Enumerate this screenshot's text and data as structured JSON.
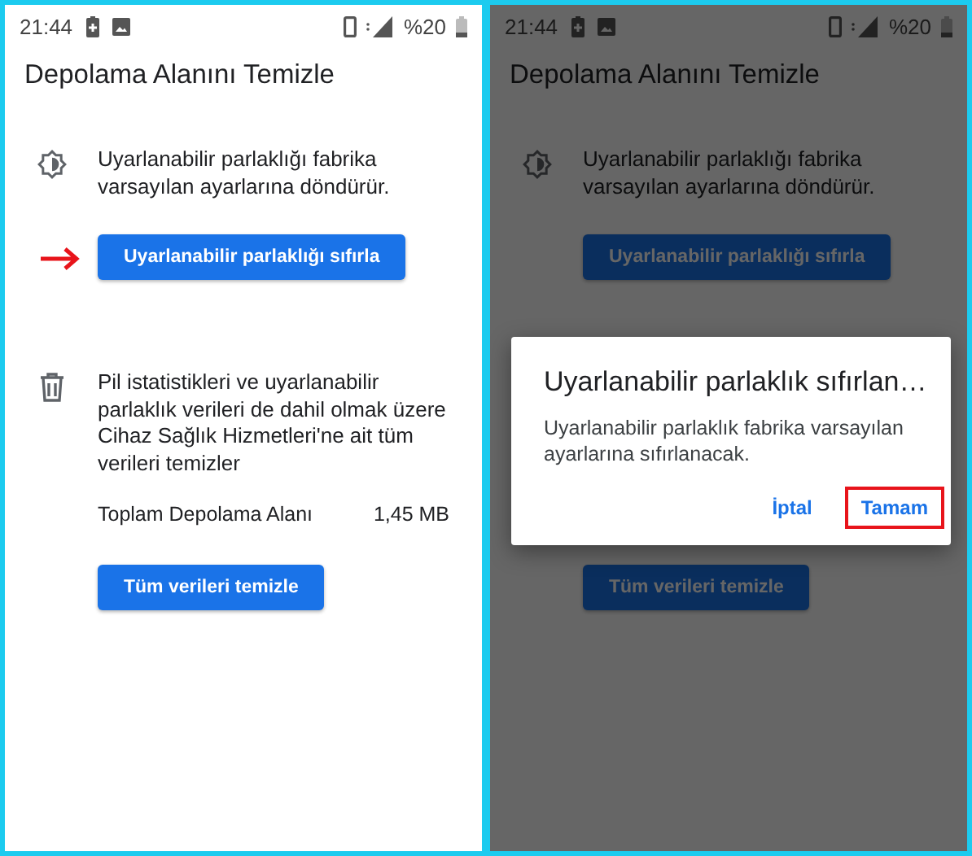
{
  "screens": [
    {
      "status_bar": {
        "time": "21:44",
        "battery": "%20"
      },
      "title": "Depolama Alanını Temizle",
      "dimmed": false,
      "sections": [
        {
          "text": "Uyarlanabilir parlaklığı fabrika varsayılan ayarlarına döndürür.",
          "button": {
            "label": "Uyarlanabilir parlaklığı sıfırla",
            "pointer_arrow": true
          }
        },
        {
          "text": "Pil istatistikleri ve uyarlanabilir parlaklık verileri de dahil olmak üzere Cihaz Sağlık Hizmetleri'ne ait tüm verileri temizler",
          "stat": {
            "label": "Toplam Depolama Alanı",
            "value": "1,45 MB"
          },
          "button": {
            "label": "Tüm verileri temizle",
            "pointer_arrow": false
          }
        }
      ]
    },
    {
      "status_bar": {
        "time": "21:44",
        "battery": "%20"
      },
      "title": "Depolama Alanını Temizle",
      "dimmed": true,
      "sections": [
        {
          "text": "Uyarlanabilir parlaklığı fabrika varsayılan ayarlarına döndürür.",
          "button": {
            "label": "Uyarlanabilir parlaklığı sıfırla",
            "pointer_arrow": false
          }
        },
        {
          "button": {
            "label": "Tüm verileri temizle",
            "pointer_arrow": false
          }
        }
      ],
      "dialog": {
        "title": "Uyarlanabilir parlaklık sıfırlan…",
        "message": "Uyarlanabilir parlaklık fabrika varsayılan ayarlarına sıfırlanacak.",
        "buttons": [
          {
            "label": "İptal",
            "highlighted": false
          },
          {
            "label": "Tamam",
            "highlighted": true
          }
        ]
      }
    }
  ]
}
